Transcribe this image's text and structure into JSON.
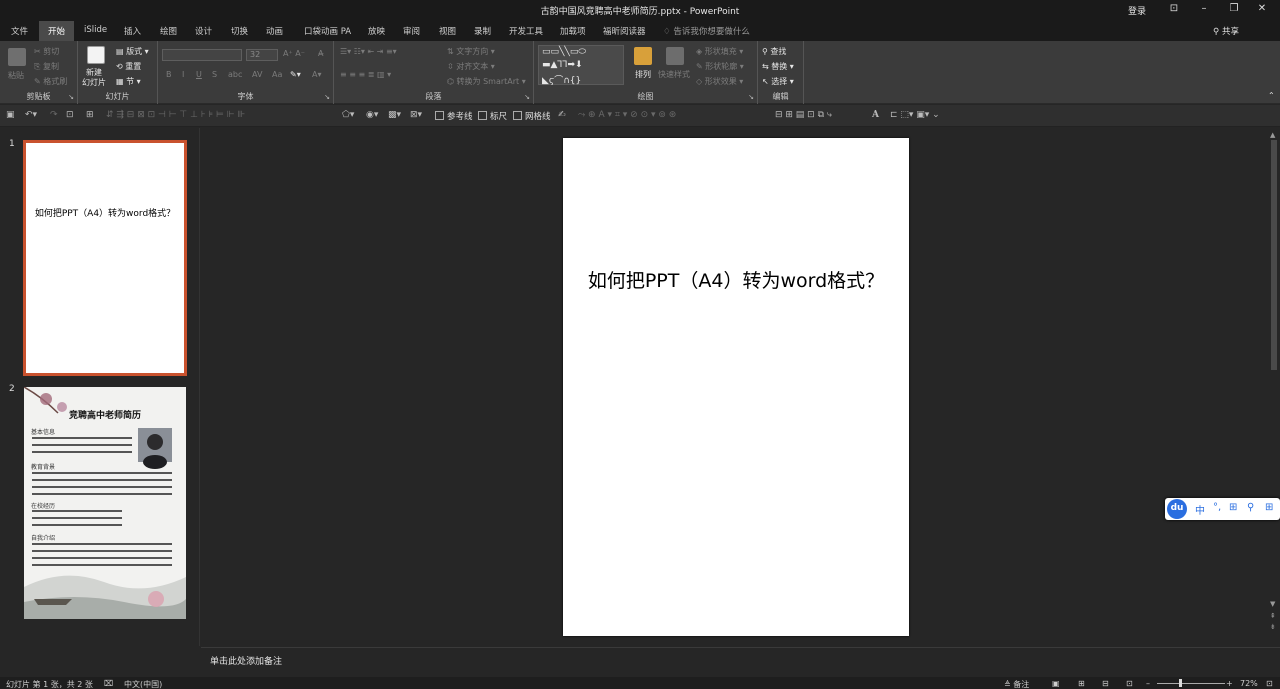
{
  "title_bar": {
    "title": "古韵中国风竞聘高中老师简历.pptx - PowerPoint",
    "login": "登录"
  },
  "tabs": [
    {
      "label": "文件"
    },
    {
      "label": "开始",
      "active": true
    },
    {
      "label": "iSlide"
    },
    {
      "label": "插入"
    },
    {
      "label": "绘图"
    },
    {
      "label": "设计"
    },
    {
      "label": "切换"
    },
    {
      "label": "动画"
    },
    {
      "label": "口袋动画 PA"
    },
    {
      "label": "放映"
    },
    {
      "label": "审阅"
    },
    {
      "label": "视图"
    },
    {
      "label": "录制"
    },
    {
      "label": "开发工具"
    },
    {
      "label": "加载项"
    },
    {
      "label": "福昕阅读器"
    }
  ],
  "tell_me": "告诉我你想要做什么",
  "share": "共享",
  "ribbon": {
    "clipboard": {
      "label": "剪贴板",
      "paste": "粘贴",
      "cut": "剪切",
      "copy": "复制",
      "format_painter": "格式刷"
    },
    "slides": {
      "label": "幻灯片",
      "new_slide": "新建\n幻灯片",
      "layout": "版式",
      "reset": "重置",
      "section": "节"
    },
    "font": {
      "label": "字体",
      "font_size": "32",
      "bold": "B",
      "italic": "I",
      "underline": "U",
      "shadow": "S"
    },
    "paragraph": {
      "label": "段落",
      "text_direction": "文字方向",
      "align_text": "对齐文本",
      "convert_smartart": "转换为 SmartArt"
    },
    "drawing": {
      "label": "绘图",
      "arrange": "排列",
      "quick_styles": "快速样式",
      "shape_fill": "形状填充",
      "shape_outline": "形状轮廓",
      "shape_effects": "形状效果"
    },
    "editing": {
      "label": "编辑",
      "find": "查找",
      "replace": "替换",
      "select": "选择"
    }
  },
  "qat": {
    "guides": "参考线",
    "ruler": "标尺",
    "gridlines": "网格线"
  },
  "thumbnails": [
    {
      "number": "1",
      "title": "如何把PPT（A4）转为word格式？"
    },
    {
      "number": "2",
      "title": "竞聘高中老师简历",
      "sections": [
        "基本信息",
        "教育背景",
        "在校经历",
        "自我介绍"
      ]
    }
  ],
  "slide": {
    "title": "如何把PPT（A4）转为word格式？"
  },
  "notes_placeholder": "单击此处添加备注",
  "status": {
    "slide_info": "幻灯片 第 1 张，共 2 张",
    "language": "中文(中国)",
    "notes": "备注",
    "zoom": "72%"
  },
  "ime": {
    "logo": "du",
    "mode": "中",
    "punct": "°,"
  },
  "colors": {
    "accent": "#c9522e",
    "ribbon_bg": "#3b3b3b",
    "titlebar_bg": "#1a1a1a",
    "canvas_bg": "#262626"
  }
}
